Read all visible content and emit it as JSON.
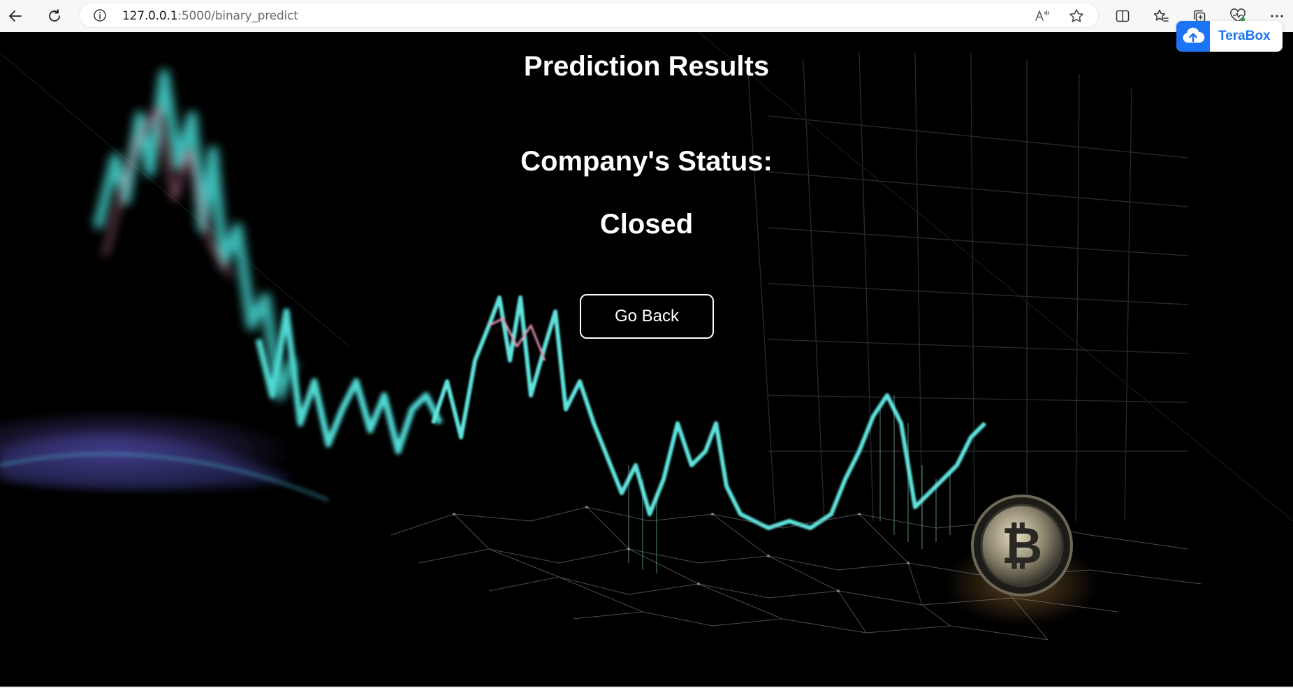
{
  "browser": {
    "url_host": "127.0.0.1",
    "url_path": ":5000/binary_predict",
    "extension_label": "TeraBox"
  },
  "page": {
    "title": "Prediction Results",
    "status_label": "Company's Status:",
    "status_value": "Closed",
    "go_back_label": "Go Back"
  },
  "colors": {
    "background": "#000000",
    "text": "#ffffff",
    "accent_teal": "#3fd6d0",
    "accent_pink": "#e58ab2",
    "terabox_blue": "#1b74f5"
  },
  "icons": {
    "back": "arrow-left-icon",
    "reload": "reload-icon",
    "info": "info-icon",
    "read_aloud": "read-aloud-icon",
    "favorite": "star-icon",
    "split_screen": "split-screen-icon",
    "favorites": "favorites-icon",
    "collections": "collections-icon",
    "browser_essentials": "heart-pulse-icon",
    "menu": "more-icon",
    "terabox": "cloud-upload-icon"
  }
}
